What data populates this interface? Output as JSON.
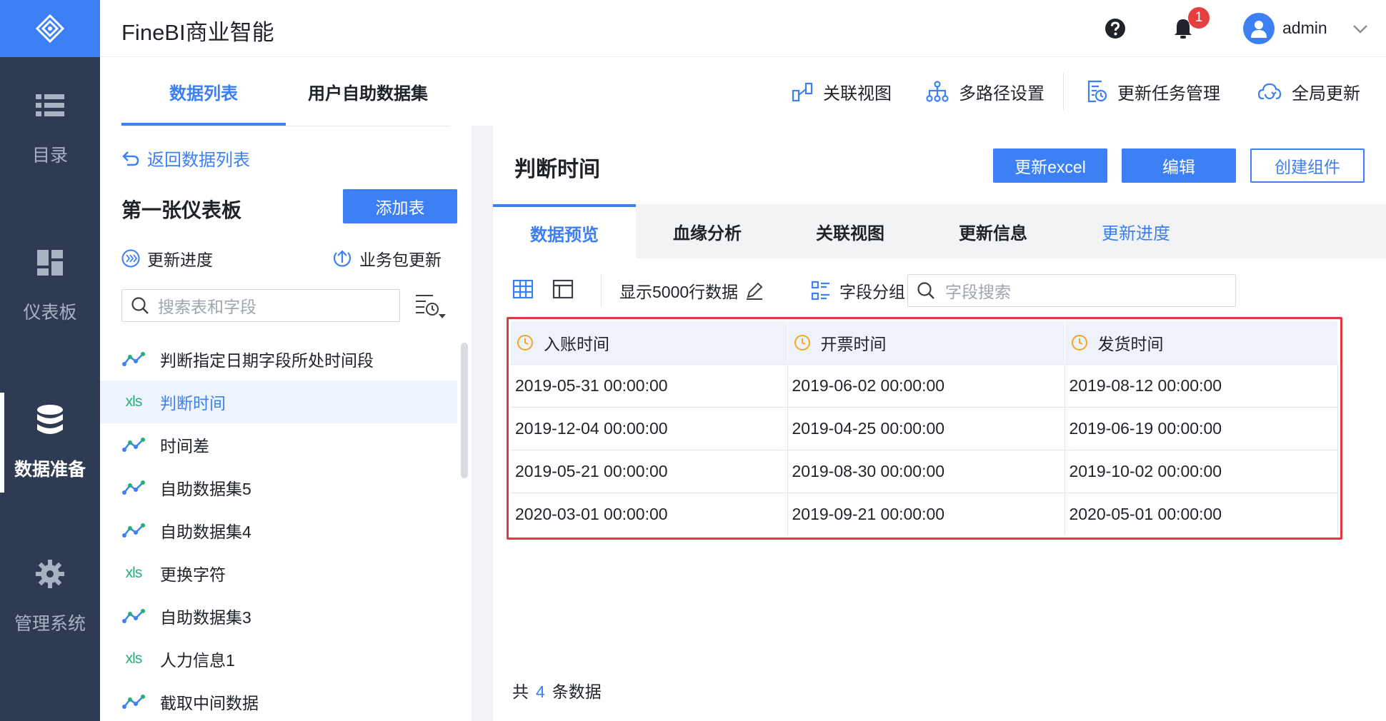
{
  "header": {
    "app_title": "FineBI商业智能",
    "notification_count": "1",
    "username": "admin"
  },
  "rail": {
    "items": [
      {
        "label": "目录",
        "icon": "list-icon"
      },
      {
        "label": "仪表板",
        "icon": "dashboard-icon"
      },
      {
        "label": "数据准备",
        "icon": "database-icon",
        "active": true
      },
      {
        "label": "管理系统",
        "icon": "gear-icon"
      }
    ]
  },
  "left_panel": {
    "tabs": [
      "数据列表",
      "用户自助数据集"
    ],
    "back_link": "返回数据列表",
    "package_title": "第一张仪表板",
    "add_table_label": "添加表",
    "update_progress_label": "更新进度",
    "package_update_label": "业务包更新",
    "search_placeholder": "搜索表和字段",
    "items": [
      {
        "label": "判断指定日期字段所处时间段",
        "type": "dataset"
      },
      {
        "label": "判断时间",
        "type": "xls",
        "active": true
      },
      {
        "label": "时间差",
        "type": "dataset"
      },
      {
        "label": "自助数据集5",
        "type": "dataset"
      },
      {
        "label": "自助数据集4",
        "type": "dataset"
      },
      {
        "label": "更换字符",
        "type": "xls"
      },
      {
        "label": "自助数据集3",
        "type": "dataset"
      },
      {
        "label": "人力信息1",
        "type": "xls"
      },
      {
        "label": "截取中间数据",
        "type": "dataset"
      }
    ],
    "xls_glyph": "xls"
  },
  "toolbar": {
    "relation_view": "关联视图",
    "multipath": "多路径设置",
    "task_manage": "更新任务管理",
    "global_update": "全局更新"
  },
  "card": {
    "title": "判断时间",
    "btn_update_excel": "更新excel",
    "btn_edit": "编辑",
    "btn_create_component": "创建组件",
    "tabs": [
      "数据预览",
      "血缘分析",
      "关联视图",
      "更新信息",
      "更新进度"
    ]
  },
  "preview": {
    "rows_label": "显示5000行数据",
    "field_group_label": "字段分组",
    "field_search_placeholder": "字段搜索",
    "columns": [
      "入账时间",
      "开票时间",
      "发货时间"
    ],
    "rows": [
      [
        "2019-05-31 00:00:00",
        "2019-06-02 00:00:00",
        "2019-08-12 00:00:00"
      ],
      [
        "2019-12-04 00:00:00",
        "2019-04-25 00:00:00",
        "2019-06-19 00:00:00"
      ],
      [
        "2019-05-21 00:00:00",
        "2019-08-30 00:00:00",
        "2019-10-02 00:00:00"
      ],
      [
        "2020-03-01 00:00:00",
        "2019-09-21 00:00:00",
        "2020-05-01 00:00:00"
      ]
    ],
    "total_prefix": "共",
    "total_count": "4",
    "total_suffix": "条数据"
  },
  "colors": {
    "accent": "#3d80f6",
    "rail_bg": "#2e3b52",
    "highlight_border": "#e0383e",
    "xls_green": "#21b27a",
    "time_icon_orange": "#f5a623"
  }
}
